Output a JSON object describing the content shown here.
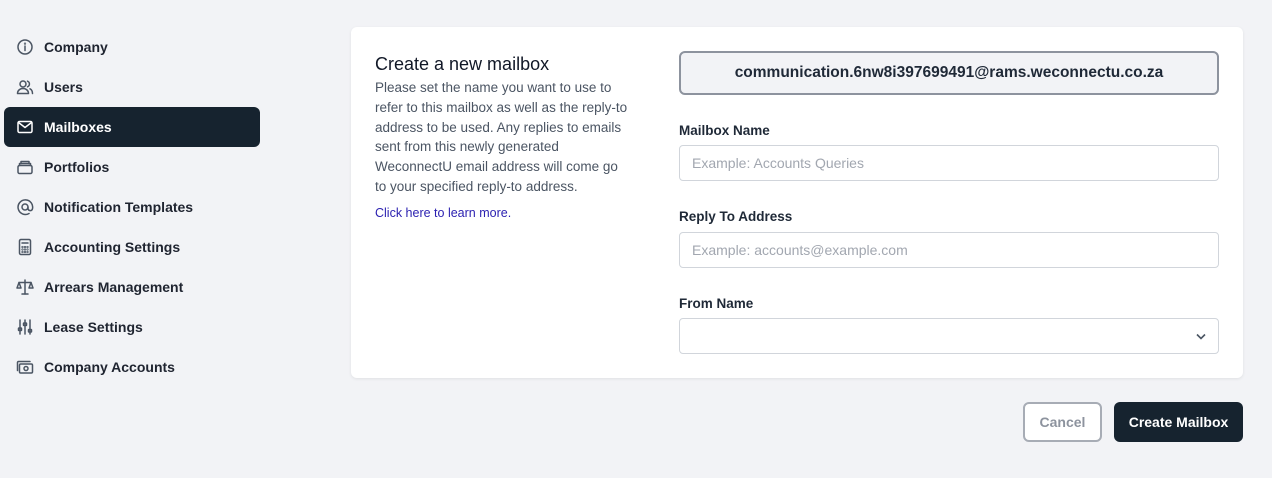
{
  "sidebar": {
    "items": [
      {
        "label": "Company",
        "icon": "info-circle-icon"
      },
      {
        "label": "Users",
        "icon": "users-icon"
      },
      {
        "label": "Mailboxes",
        "icon": "mail-icon",
        "active": true
      },
      {
        "label": "Portfolios",
        "icon": "portfolio-stack-icon"
      },
      {
        "label": "Notification Templates",
        "icon": "at-sign-icon"
      },
      {
        "label": "Accounting Settings",
        "icon": "calculator-icon"
      },
      {
        "label": "Arrears Management",
        "icon": "scales-icon"
      },
      {
        "label": "Lease Settings",
        "icon": "sliders-icon"
      },
      {
        "label": "Company Accounts",
        "icon": "cash-icon"
      }
    ]
  },
  "form": {
    "title": "Create a new mailbox",
    "description": "Please set the name you want to use to refer to this mailbox as well as the reply-to address to be used. Any replies to emails sent from this newly generated WeconnectU email address will come go to your specified reply-to address.",
    "learn_more": "Click here to learn more.",
    "generated_address": "communication.6nw8i397699491@rams.weconnectu.co.za",
    "mailbox_name": {
      "label": "Mailbox Name",
      "value": "",
      "placeholder": "Example: Accounts Queries"
    },
    "reply_to": {
      "label": "Reply To Address",
      "value": "",
      "placeholder": "Example: accounts@example.com"
    },
    "from_name": {
      "label": "From Name",
      "value": ""
    }
  },
  "actions": {
    "cancel_label": "Cancel",
    "create_label": "Create Mailbox"
  },
  "colors": {
    "accent": "#16232f",
    "background": "#f2f3f6",
    "link": "#2a1fb0"
  }
}
